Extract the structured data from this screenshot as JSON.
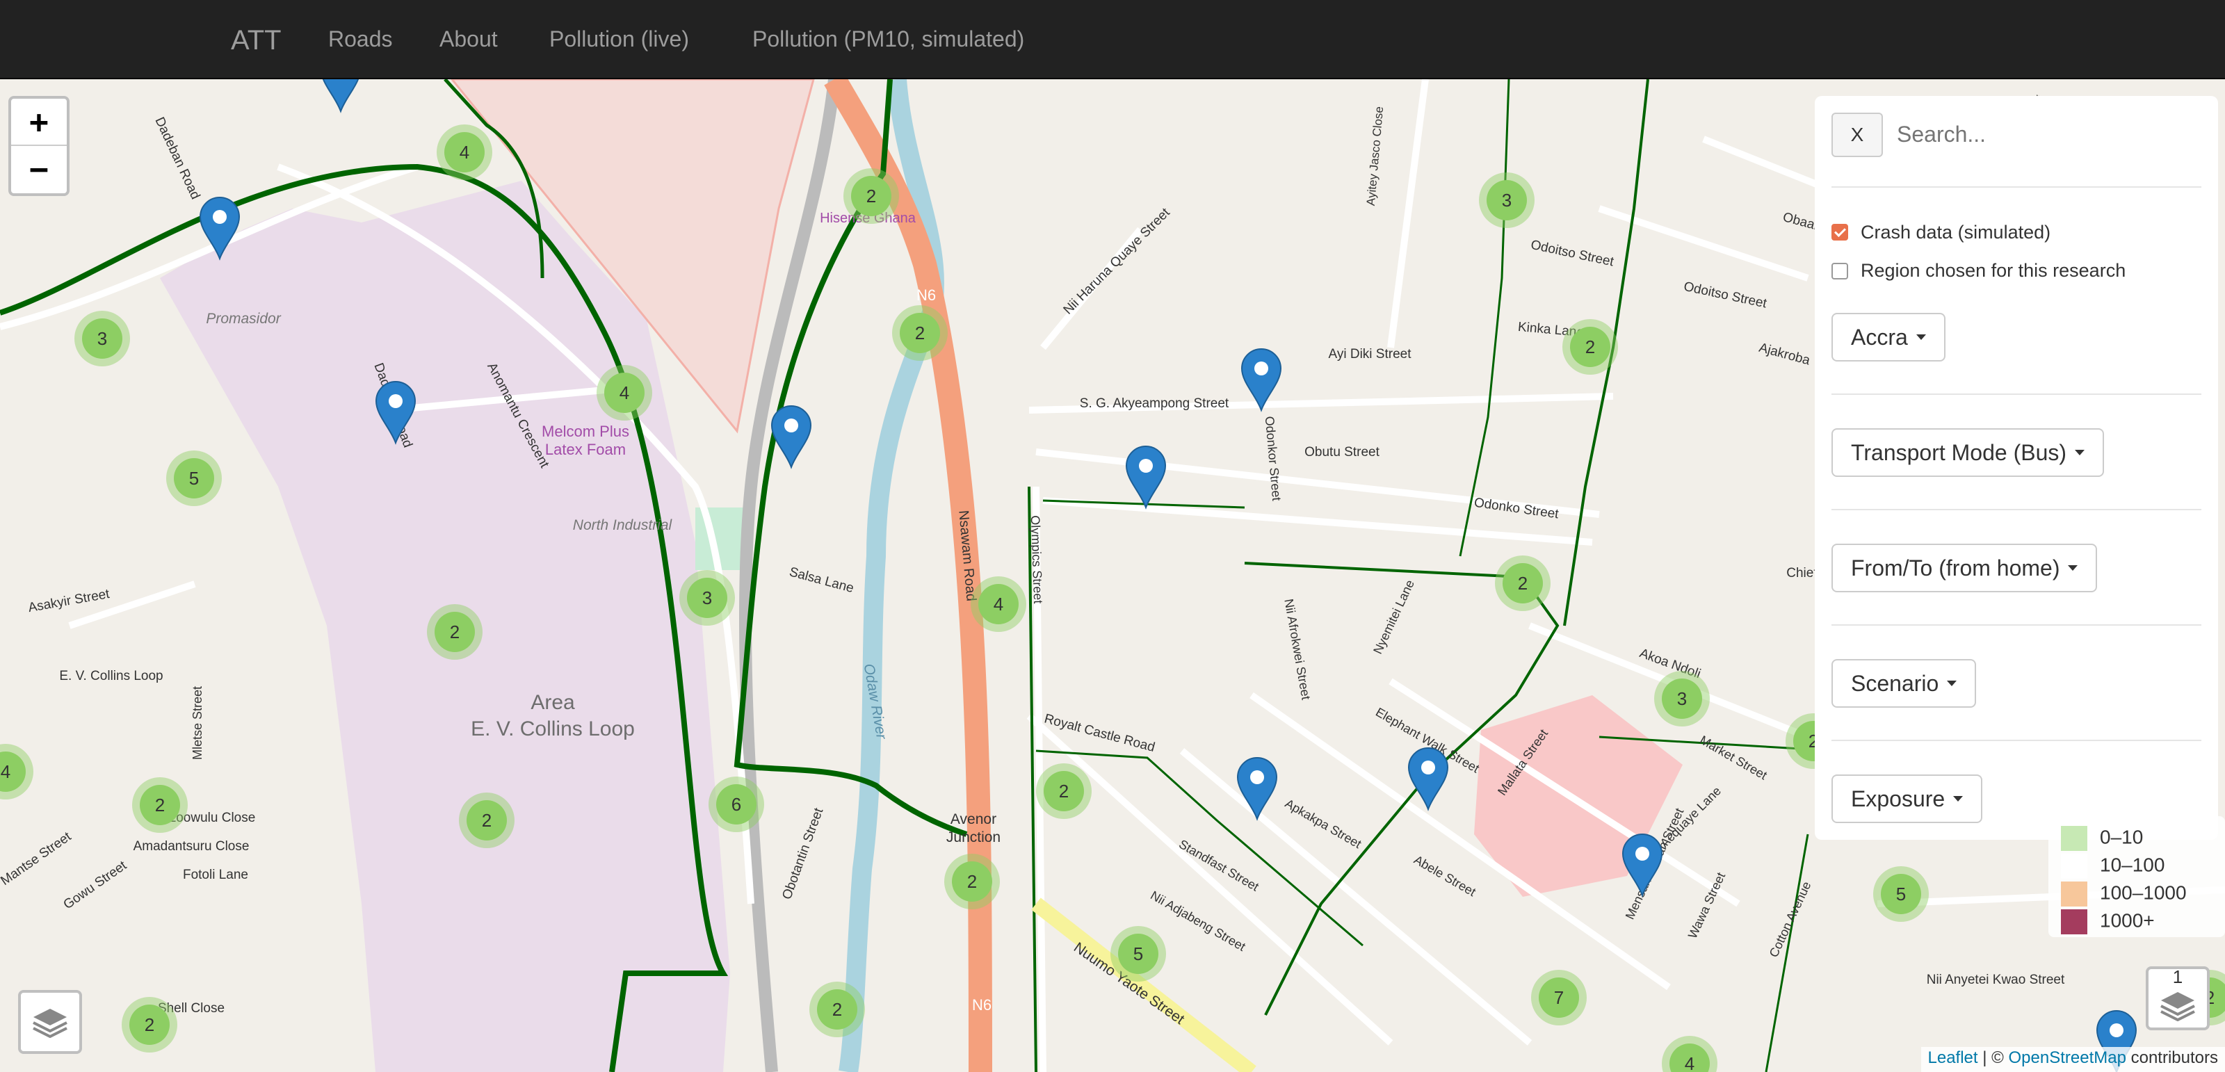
{
  "navbar": {
    "brand": "ATT",
    "links": [
      "Roads",
      "About",
      "Pollution (live)",
      "Pollution (PM10, simulated)"
    ]
  },
  "zoom": {
    "in_label": "+",
    "out_label": "−"
  },
  "panel": {
    "close_label": "X",
    "search_placeholder": "Search...",
    "checkboxes": [
      {
        "label": "Crash data (simulated)",
        "checked": true
      },
      {
        "label": "Region chosen for this research",
        "checked": false
      }
    ],
    "dropdowns": [
      "Accra",
      "Transport Mode (Bus)",
      "From/To (from home)",
      "Scenario",
      "Exposure"
    ]
  },
  "legend": {
    "items": [
      {
        "label": "0–10",
        "color": "#c7e9b4"
      },
      {
        "label": "10–100",
        "color": "#ffffff"
      },
      {
        "label": "100–1000",
        "color": "#f7c79b"
      },
      {
        "label": "1000+",
        "color": "#a43c5e"
      }
    ]
  },
  "colors": {
    "cluster": "#8dce63",
    "marker": "#2a81cb",
    "route": "#006400",
    "industrial": "#eadcea",
    "trunk": "#f4a07d",
    "river": "#aad3df"
  },
  "map_labels": [
    "Dadeban Road",
    "Promasidor",
    "Dadeban Road",
    "Anomantu Crescent",
    "Melcom Plus",
    "Latex Foam",
    "North Industrial",
    "Area",
    "E. V. Collins Loop",
    "Asakyir Street",
    "E. V. Collins Loop",
    "Mletse Street",
    "Loowulu Close",
    "Amadantsuru Close",
    "Fotoli Lane",
    "Shell Close",
    "Gowu Street",
    "Mantse Street",
    "Salsa Lane",
    "Odaw River",
    "Nsawam Road",
    "N6",
    "N6",
    "Avenor",
    "Junction",
    "Obotantin Street",
    "Olympics Street",
    "Royalt Castle Road",
    "Nii Haruna Quaye Street",
    "S. G. Akyeampong Street",
    "Ayi Diki Street",
    "Obutu Street",
    "Odonko Street",
    "Nii Afrokwei Street",
    "Nyemitei Lane",
    "Elephant Walk Street",
    "Apkakpa Street",
    "Standfast Street",
    "Nii Adjabeng Street",
    "Nuumo Yaote Street",
    "Odonkor Street",
    "Odoitso Street",
    "Odoitso Street",
    "Obaakrowa",
    "Kinka Lane",
    "Ajakroba",
    "Chief Chamba",
    "Akoa Ndoli",
    "Mallata Street",
    "Market Street",
    "Mary Acquaye Lane",
    "Mensah Sabah Street",
    "Wawa Street",
    "Abele Street",
    "Cotton Avenue",
    "Nii Anyetei Kwao Street",
    "Hisense Ghana",
    "Asafoanye Street",
    "Ayitey Jasco Close"
  ],
  "clusters": [
    "4",
    "3",
    "5",
    "4",
    "2",
    "2",
    "2",
    "3",
    "4",
    "2",
    "6",
    "2",
    "2",
    "2",
    "2",
    "5",
    "3",
    "2",
    "2",
    "3",
    "5",
    "7",
    "4",
    "2",
    "4",
    "2",
    "2"
  ],
  "minimap_count": "1",
  "attribution": {
    "leaflet": "Leaflet",
    "sep": " | © ",
    "osm": "OpenStreetMap",
    "suffix": " contributors"
  }
}
